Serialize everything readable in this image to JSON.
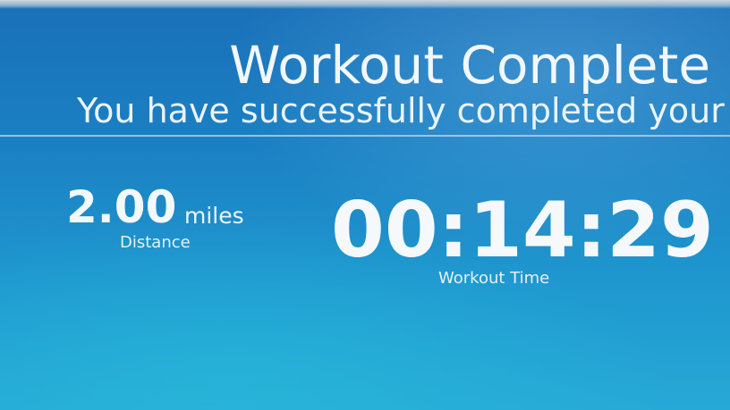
{
  "header": {
    "title": "Workout Complete",
    "subtitle": "You have successfully completed your"
  },
  "stats": {
    "distance": {
      "value": "2.00",
      "unit": "miles",
      "label": "Distance"
    },
    "time": {
      "value": "00:14:29",
      "label": "Workout Time"
    }
  },
  "colors": {
    "background": "#1d86c4",
    "text": "#f2f7fb"
  }
}
